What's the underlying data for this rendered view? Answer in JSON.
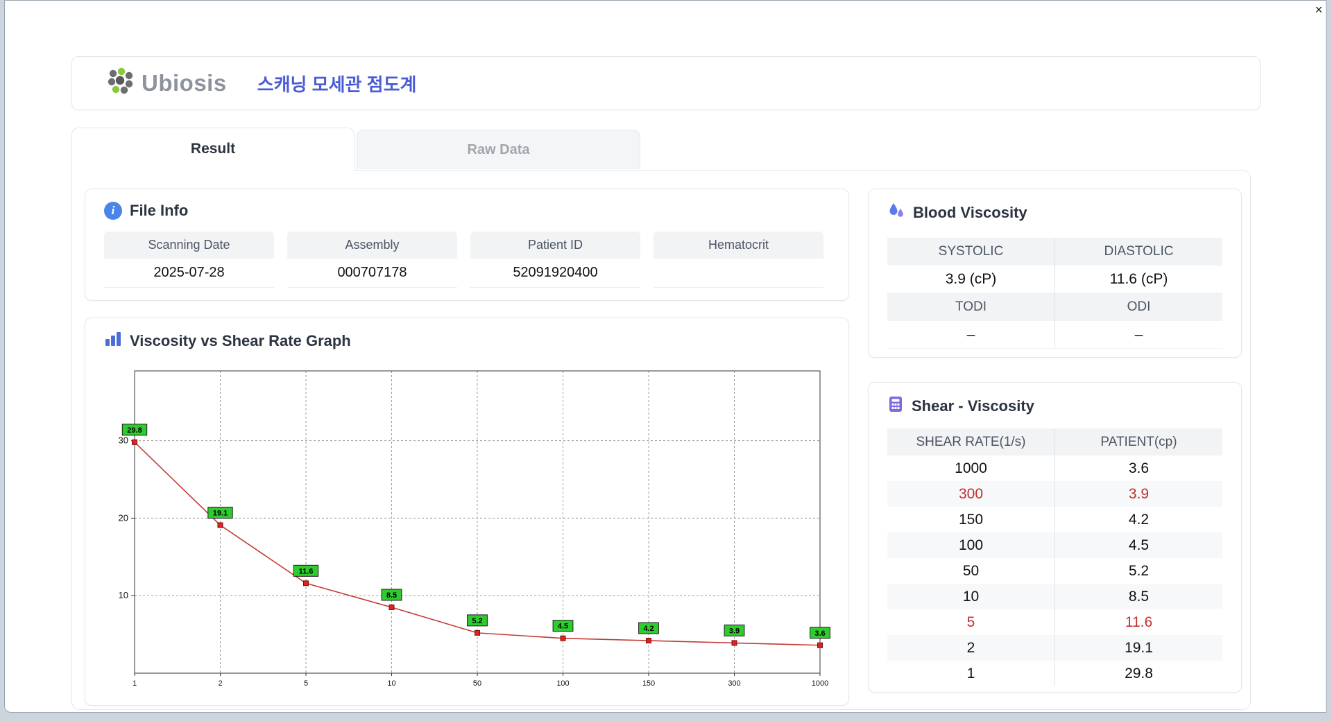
{
  "window": {
    "close_label": "×"
  },
  "header": {
    "logo_text": "Ubiosis",
    "title": "스캐닝 모세관 점도계"
  },
  "tabs": [
    {
      "label": "Result",
      "active": true
    },
    {
      "label": "Raw Data",
      "active": false
    }
  ],
  "file_info": {
    "title": "File Info",
    "fields": [
      {
        "label": "Scanning Date",
        "value": "2025-07-28"
      },
      {
        "label": "Assembly",
        "value": "000707178"
      },
      {
        "label": "Patient ID",
        "value": "52091920400"
      },
      {
        "label": "Hematocrit",
        "value": ""
      }
    ]
  },
  "graph": {
    "title": "Viscosity vs Shear Rate Graph"
  },
  "chart_data": {
    "type": "line",
    "title": "Viscosity vs Shear Rate Graph",
    "categories": [
      "1",
      "2",
      "5",
      "10",
      "50",
      "100",
      "150",
      "300",
      "1000"
    ],
    "values": [
      29.8,
      19.1,
      11.6,
      8.5,
      5.2,
      4.5,
      4.2,
      3.9,
      3.6
    ],
    "xlabel": "",
    "ylabel": "",
    "yticks": [
      10,
      20,
      30
    ],
    "ylim": [
      0,
      39
    ],
    "grid": true,
    "line_color": "#c23b35",
    "marker_color": "#e02222",
    "label_bg": "#2ecc2e"
  },
  "blood_viscosity": {
    "title": "Blood Viscosity",
    "rows": [
      {
        "h1": "SYSTOLIC",
        "h2": "DIASTOLIC",
        "v1": "3.9 (cP)",
        "v2": "11.6 (cP)"
      },
      {
        "h1": "TODI",
        "h2": "ODI",
        "v1": "–",
        "v2": "–"
      }
    ]
  },
  "shear_viscosity": {
    "title": "Shear - Viscosity",
    "columns": [
      "SHEAR RATE(1/s)",
      "PATIENT(cp)"
    ],
    "rows": [
      {
        "rate": "1000",
        "value": "3.6",
        "highlight": false
      },
      {
        "rate": "300",
        "value": "3.9",
        "highlight": true
      },
      {
        "rate": "150",
        "value": "4.2",
        "highlight": false
      },
      {
        "rate": "100",
        "value": "4.5",
        "highlight": false
      },
      {
        "rate": "50",
        "value": "5.2",
        "highlight": false
      },
      {
        "rate": "10",
        "value": "8.5",
        "highlight": false
      },
      {
        "rate": "5",
        "value": "11.6",
        "highlight": true
      },
      {
        "rate": "2",
        "value": "19.1",
        "highlight": false
      },
      {
        "rate": "1",
        "value": "29.8",
        "highlight": false
      }
    ]
  }
}
